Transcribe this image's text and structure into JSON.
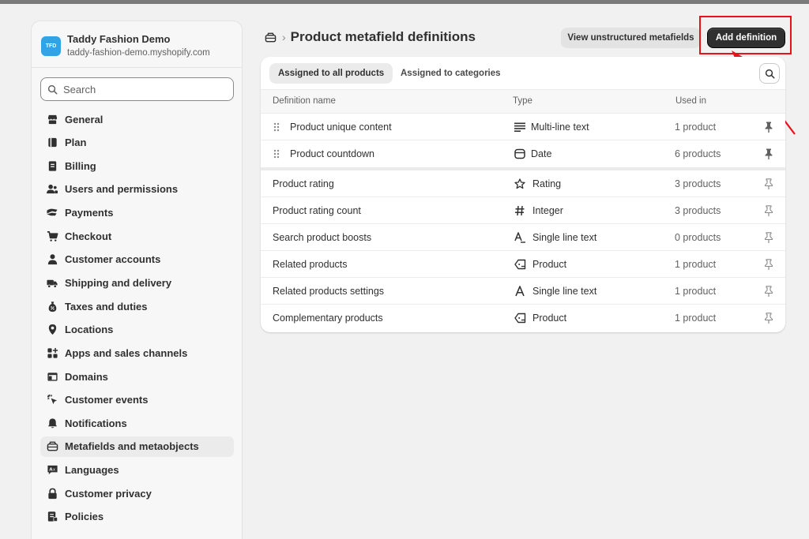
{
  "store": {
    "avatar_initials": "TFD",
    "name": "Taddy Fashion Demo",
    "domain": "taddy-fashion-demo.myshopify.com"
  },
  "search": {
    "placeholder": "Search"
  },
  "sidebar": {
    "items": [
      {
        "label": "General",
        "icon": "store-icon"
      },
      {
        "label": "Plan",
        "icon": "plan-icon"
      },
      {
        "label": "Billing",
        "icon": "billing-icon"
      },
      {
        "label": "Users and permissions",
        "icon": "users-icon"
      },
      {
        "label": "Payments",
        "icon": "payments-icon"
      },
      {
        "label": "Checkout",
        "icon": "cart-icon"
      },
      {
        "label": "Customer accounts",
        "icon": "person-icon"
      },
      {
        "label": "Shipping and delivery",
        "icon": "truck-icon"
      },
      {
        "label": "Taxes and duties",
        "icon": "tax-icon"
      },
      {
        "label": "Locations",
        "icon": "location-icon"
      },
      {
        "label": "Apps and sales channels",
        "icon": "apps-icon"
      },
      {
        "label": "Domains",
        "icon": "globe-icon"
      },
      {
        "label": "Customer events",
        "icon": "cursor-icon"
      },
      {
        "label": "Notifications",
        "icon": "bell-icon"
      },
      {
        "label": "Metafields and metaobjects",
        "icon": "metafields-icon"
      },
      {
        "label": "Languages",
        "icon": "language-icon"
      },
      {
        "label": "Customer privacy",
        "icon": "lock-icon"
      },
      {
        "label": "Policies",
        "icon": "policy-icon"
      }
    ],
    "active_label": "Metafields and metaobjects"
  },
  "header": {
    "title": "Product metafield definitions",
    "view_unstructured_label": "View unstructured metafields",
    "add_definition_label": "Add definition"
  },
  "tabs": [
    {
      "label": "Assigned to all products",
      "selected": true
    },
    {
      "label": "Assigned to categories",
      "selected": false
    }
  ],
  "table": {
    "columns": [
      "Definition name",
      "Type",
      "Used in"
    ],
    "rows": [
      {
        "name": "Product unique content",
        "type": "Multi-line text",
        "type_icon": "multiline-text-icon",
        "used_in": "1 product",
        "pinned": true
      },
      {
        "name": "Product countdown",
        "type": "Date",
        "type_icon": "calendar-icon",
        "used_in": "6 products",
        "pinned": true
      },
      {
        "name": "Product rating",
        "type": "Rating",
        "type_icon": "star-icon",
        "used_in": "3 products",
        "pinned": false
      },
      {
        "name": "Product rating count",
        "type": "Integer",
        "type_icon": "hash-icon",
        "used_in": "3 products",
        "pinned": false
      },
      {
        "name": "Search product boosts",
        "type": "Single line text",
        "type_icon": "text-list-icon",
        "used_in": "0 products",
        "pinned": false
      },
      {
        "name": "Related products",
        "type": "Product",
        "type_icon": "product-tag-icon",
        "used_in": "1 product",
        "pinned": false
      },
      {
        "name": "Related products settings",
        "type": "Single line text",
        "type_icon": "text-icon",
        "used_in": "1 product",
        "pinned": false
      },
      {
        "name": "Complementary products",
        "type": "Product",
        "type_icon": "product-tag-icon",
        "used_in": "1 product",
        "pinned": false
      }
    ]
  },
  "colors": {
    "annotation": "#e8121b",
    "primary_button": "#303030",
    "avatar": "#2fa4e7"
  }
}
